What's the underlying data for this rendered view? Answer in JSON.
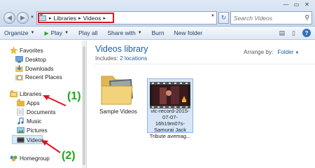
{
  "address": {
    "crumbs": [
      "Libraries",
      "Videos"
    ],
    "separator": "▸",
    "search_placeholder": "Search Videos"
  },
  "toolbar": {
    "organize": "Organize",
    "play": "Play",
    "play_all": "Play all",
    "share_with": "Share with",
    "burn": "Burn",
    "new_folder": "New folder"
  },
  "nav": {
    "favorites": "Favorites",
    "desktop": "Desktop",
    "downloads": "Downloads",
    "recent_places": "Recent Places",
    "libraries": "Libraries",
    "apps": "Apps",
    "documents": "Documents",
    "music": "Music",
    "pictures": "Pictures",
    "videos": "Videos",
    "homegroup": "Homegroup"
  },
  "content": {
    "title": "Videos library",
    "includes_label": "Includes:",
    "includes_link": "2 locations",
    "arrange_label": "Arrange by:",
    "arrange_value": "Folder",
    "items": [
      {
        "label": "Sample Videos"
      },
      {
        "label": "vlc-record-2015-07-07-16h19m07s-Samurai Jack Tribute avemag..."
      }
    ]
  },
  "annotations": {
    "one": "(1)",
    "two": "(2)"
  },
  "colors": {
    "annotation_red": "#e0141b",
    "annotation_green": "#1fa51a",
    "link_blue": "#1e5ea3"
  }
}
